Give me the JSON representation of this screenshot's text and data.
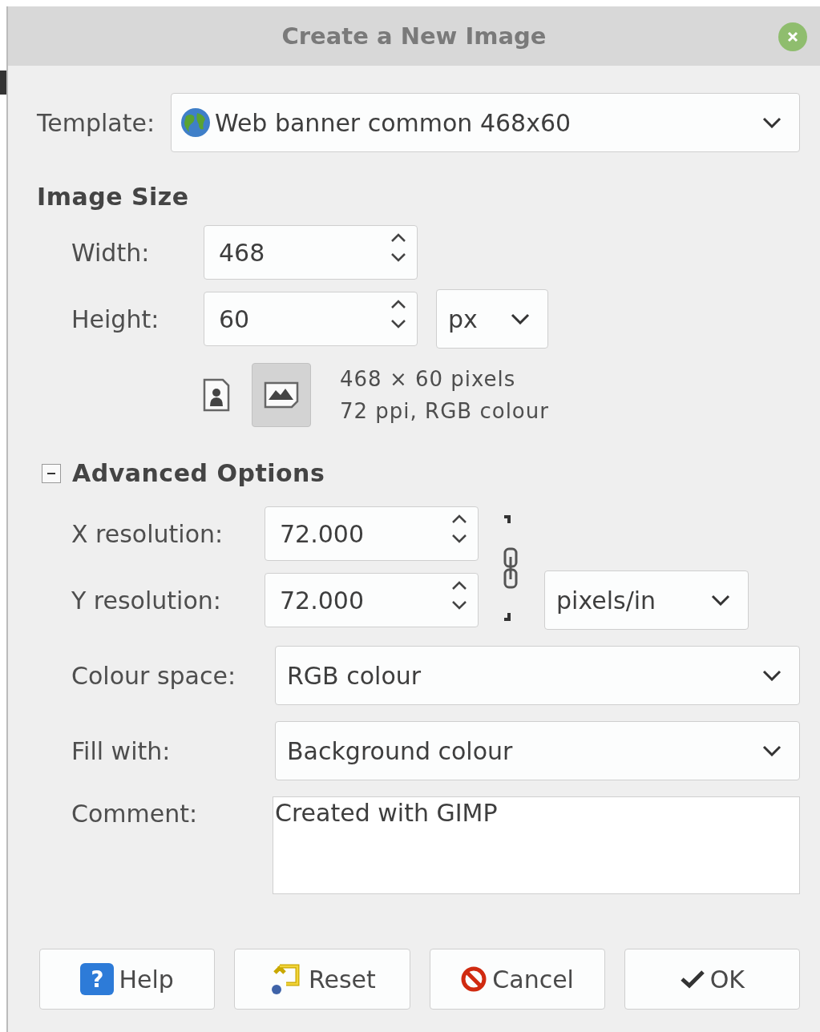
{
  "window": {
    "title": "Create a New Image"
  },
  "template": {
    "label": "Template:",
    "value": "Web banner common 468x60"
  },
  "image_size": {
    "heading": "Image Size",
    "width": {
      "label": "Width:",
      "value": "468"
    },
    "height": {
      "label": "Height:",
      "value": "60"
    },
    "unit": "px",
    "orientation": [
      {
        "kind": "portrait",
        "selected": false
      },
      {
        "kind": "landscape",
        "selected": true
      }
    ],
    "info": [
      "468 × 60 pixels",
      "72 ppi, RGB colour"
    ]
  },
  "advanced": {
    "label": "Advanced Options",
    "expanded": true,
    "x_resolution": {
      "label": "X resolution:",
      "value": "72.000"
    },
    "y_resolution": {
      "label": "Y resolution:",
      "value": "72.000"
    },
    "resolution_unit": "pixels/in",
    "colour_space": {
      "label": "Colour space:",
      "value": "RGB colour"
    },
    "fill_with": {
      "label": "Fill with:",
      "value": "Background colour"
    },
    "comment": {
      "label": "Comment:",
      "value": "Created with GIMP"
    }
  },
  "buttons": [
    {
      "kind": "help",
      "label": "Help",
      "icon_glyph": "?"
    },
    {
      "kind": "reset",
      "label": "Reset"
    },
    {
      "kind": "cancel",
      "label": "Cancel"
    },
    {
      "kind": "ok",
      "label": "OK"
    }
  ]
}
